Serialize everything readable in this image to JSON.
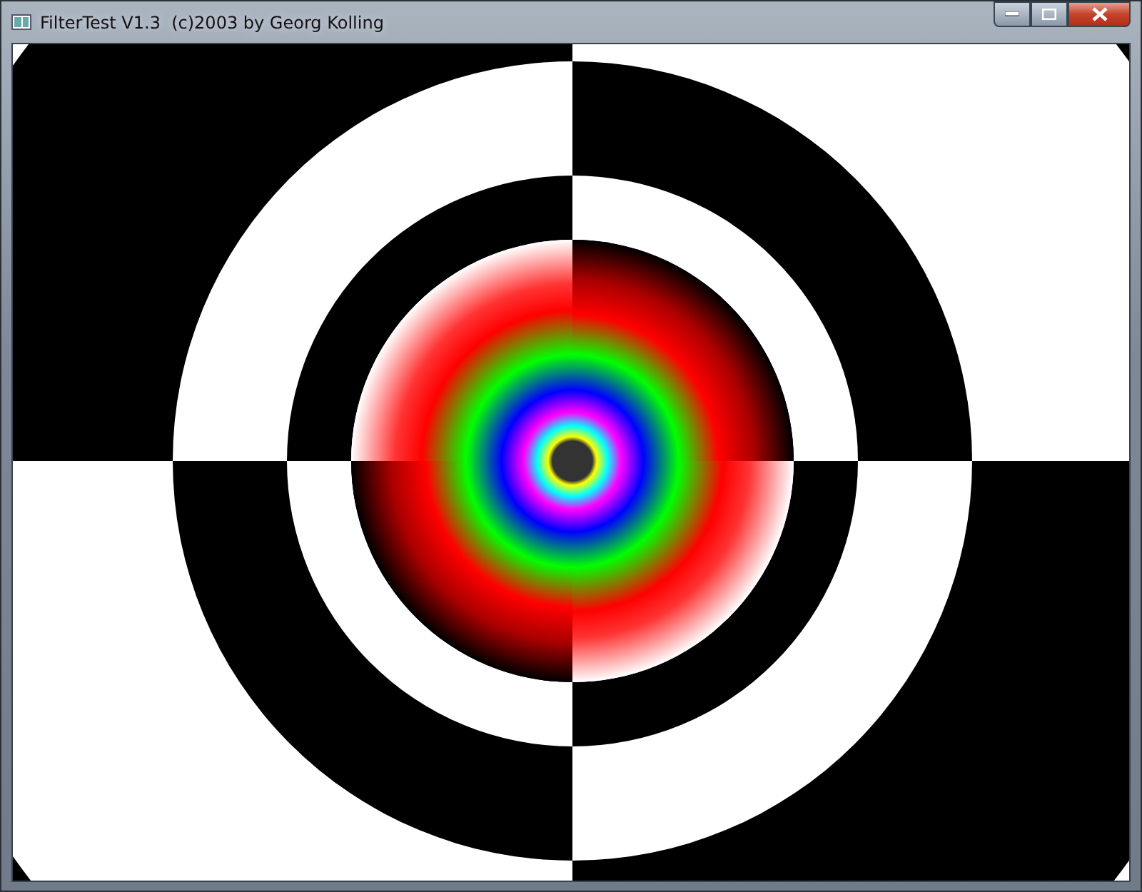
{
  "window": {
    "title": "FilterTest V1.3  (c)2003 by Georg Kolling"
  }
}
